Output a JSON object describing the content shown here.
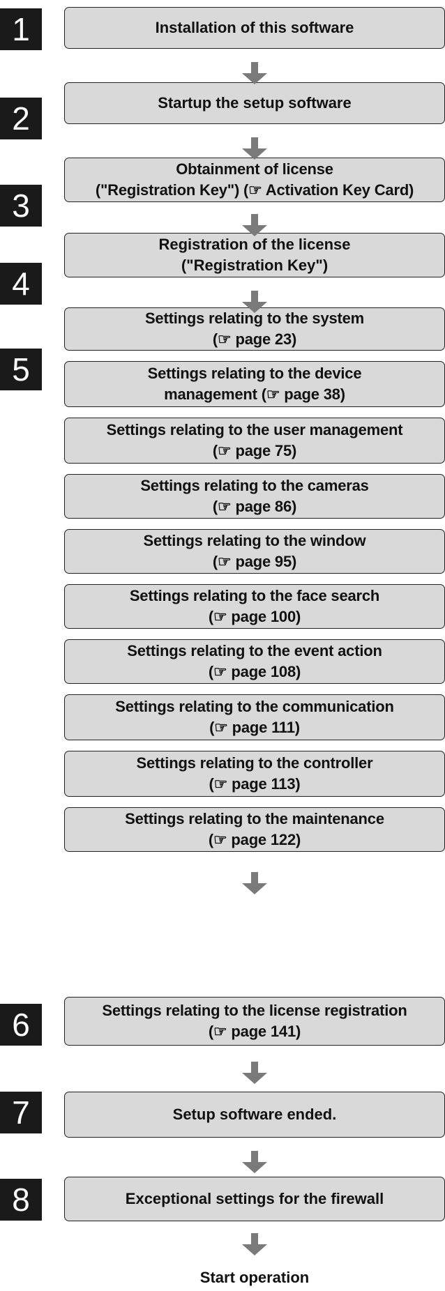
{
  "steps": [
    {
      "number": "1",
      "lines": [
        "Installation of this software"
      ]
    },
    {
      "number": "2",
      "lines": [
        "Startup the setup software"
      ]
    },
    {
      "number": "3",
      "lines": [
        "Obtainment of license",
        "(\"Registration Key\") (☞ Activation Key Card)"
      ]
    },
    {
      "number": "4",
      "lines": [
        "Registration of the license",
        "(\"Registration Key\")"
      ]
    },
    {
      "number": "5",
      "items": [
        [
          "Settings relating to the system",
          "(☞ page 23)"
        ],
        [
          "Settings relating to the device",
          "management (☞ page 38)"
        ],
        [
          "Settings relating to the user management",
          "(☞ page 75)"
        ],
        [
          "Settings relating to the cameras",
          "(☞ page 86)"
        ],
        [
          "Settings relating to the window",
          "(☞ page 95)"
        ],
        [
          "Settings relating to the face search",
          "(☞ page 100)"
        ],
        [
          "Settings relating to the event action",
          "(☞ page 108)"
        ],
        [
          "Settings relating to the communication",
          "(☞ page 111)"
        ],
        [
          "Settings relating to the controller",
          "(☞ page 113)"
        ],
        [
          "Settings relating to the maintenance",
          "(☞ page 122)"
        ]
      ]
    },
    {
      "number": "6",
      "lines": [
        "Settings relating to the license registration",
        "(☞ page 141)"
      ]
    },
    {
      "number": "7",
      "lines": [
        "Setup software ended."
      ]
    },
    {
      "number": "8",
      "lines": [
        "Exceptional settings for the firewall"
      ]
    }
  ],
  "final_label": "Start operation",
  "icons": {
    "arrow": "down-arrow-icon",
    "reference": "pointing-hand-icon"
  }
}
